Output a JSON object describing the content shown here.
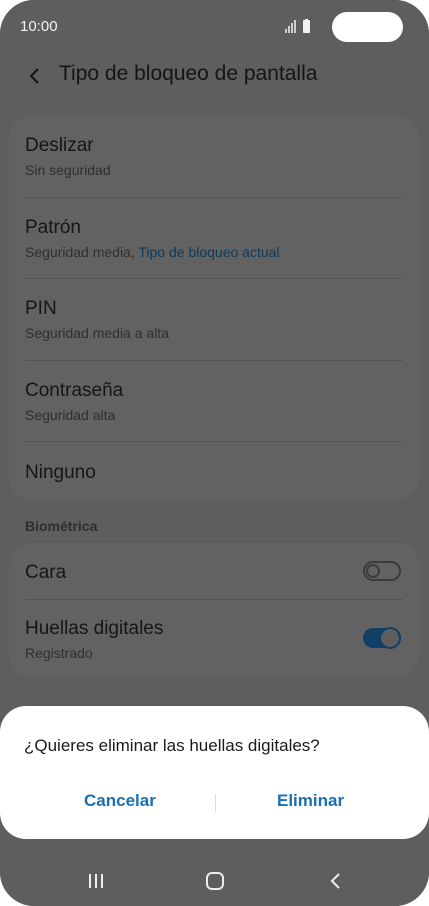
{
  "status_bar": {
    "time": "10:00"
  },
  "header": {
    "title": "Tipo de bloqueo de pantalla"
  },
  "lock_types": [
    {
      "title": "Deslizar",
      "subtitle": "Sin seguridad"
    },
    {
      "title": "Patrón",
      "subtitle": "Seguridad media, ",
      "current": "Tipo de bloqueo actual"
    },
    {
      "title": "PIN",
      "subtitle": "Seguridad media a alta"
    },
    {
      "title": "Contraseña",
      "subtitle": "Seguridad alta"
    },
    {
      "title": "Ninguno"
    }
  ],
  "biometrics": {
    "section": "Biométrica",
    "items": [
      {
        "title": "Cara",
        "enabled": false
      },
      {
        "title": "Huellas digitales",
        "subtitle": "Registrado",
        "enabled": true
      }
    ]
  },
  "dialog": {
    "question": "¿Quieres eliminar las huellas digitales?",
    "cancel_label": "Cancelar",
    "confirm_label": "Eliminar"
  },
  "colors": {
    "accent": "#1a6fb3",
    "toggle_on": "#123f66",
    "scrim": "#5e5e5e"
  },
  "icons": [
    "signal-icon",
    "battery-icon",
    "back-arrow-icon",
    "recent-apps-icon",
    "home-icon",
    "nav-back-icon"
  ]
}
